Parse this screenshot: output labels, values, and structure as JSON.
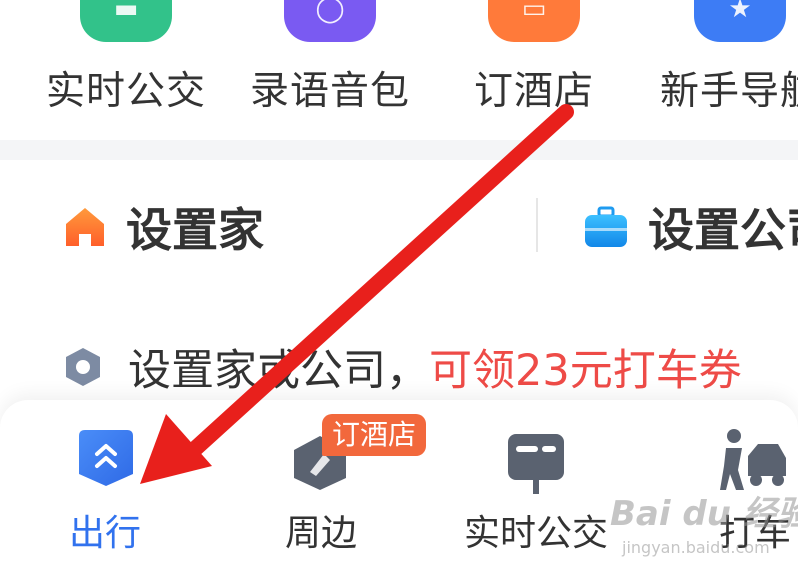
{
  "top_grid": {
    "items": [
      {
        "label": "实时公交",
        "icon": "bus-icon",
        "color": "#32c28a"
      },
      {
        "label": "录语音包",
        "icon": "voice-pack-icon",
        "color": "#7a5af2"
      },
      {
        "label": "订酒店",
        "icon": "hotel-icon",
        "color": "#ff7a3a"
      },
      {
        "label": "新手导航",
        "icon": "navigation-guide-icon",
        "color": "#3d7cf5"
      }
    ]
  },
  "shortcuts": {
    "home": {
      "label": "设置家",
      "icon": "home-icon",
      "color": "#ff7a2a"
    },
    "company": {
      "label": "设置公司",
      "icon": "briefcase-icon",
      "color": "#1e9bf0"
    }
  },
  "promo": {
    "text": "设置家或公司，",
    "highlight": "可领23元打车券",
    "icon": "hexagon-icon",
    "highlight_color": "#ee4b47"
  },
  "tabbar": {
    "tabs": [
      {
        "label": "出行",
        "icon": "travel-icon",
        "active": true
      },
      {
        "label": "周边",
        "icon": "nearby-icon",
        "active": false
      },
      {
        "label": "实时公交",
        "icon": "bus-stop-icon",
        "active": false
      },
      {
        "label": "打车",
        "icon": "taxi-icon",
        "active": false
      }
    ],
    "badge": "订酒店",
    "active_color": "#3172ee"
  },
  "watermark": {
    "text": "Bai du 经验",
    "sub": "jingyan.baidu.com"
  },
  "annotation": {
    "arrow_color": "#e8201c"
  }
}
